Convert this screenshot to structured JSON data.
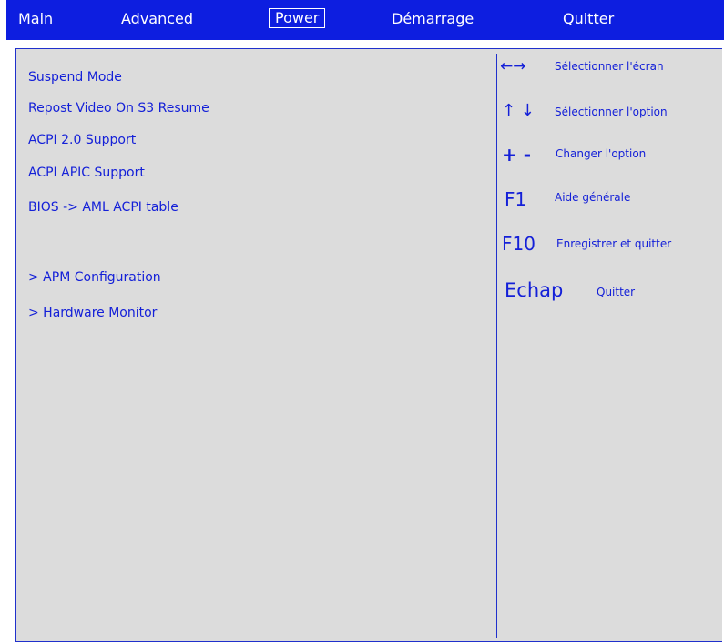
{
  "menu": {
    "tabs": [
      {
        "label": "Main"
      },
      {
        "label": "Advanced"
      },
      {
        "label": "Power",
        "active": true
      },
      {
        "label": "Démarrage"
      },
      {
        "label": "Quitter"
      }
    ]
  },
  "settings": {
    "items": [
      {
        "label": "Suspend Mode"
      },
      {
        "label": "Repost Video On S3 Resume"
      },
      {
        "label": "ACPI 2.0 Support"
      },
      {
        "label": "ACPI APIC Support"
      },
      {
        "label": "BIOS -> AML ACPI table"
      }
    ],
    "submenus": [
      {
        "label": "> APM Configuration"
      },
      {
        "label": "> Hardware Monitor"
      }
    ]
  },
  "help": {
    "rows": [
      {
        "key": "←→",
        "text": "Sélectionner l'écran"
      },
      {
        "key": "↑ ↓",
        "text": "Sélectionner l'option"
      },
      {
        "key": "+ -",
        "text": "Changer l'option"
      },
      {
        "key": "F1",
        "text": "Aide générale"
      },
      {
        "key": "F10",
        "text": "Enregistrer et quitter"
      },
      {
        "key": "Echap",
        "text": "Quitter"
      }
    ]
  },
  "colors": {
    "menubar": "#0d1ee0",
    "text": "#1420d8",
    "panel": "#dcdcdc",
    "border": "#2030cc"
  }
}
